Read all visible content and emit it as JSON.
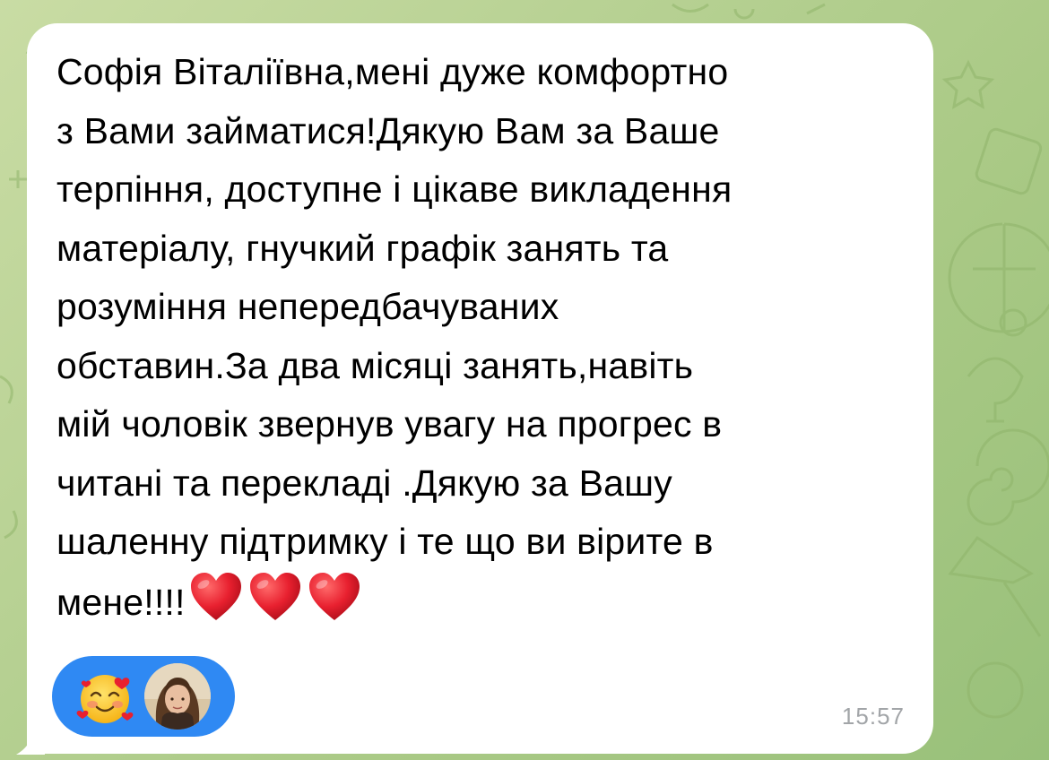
{
  "message": {
    "text": "Софія Віталіївна,мені дуже комфортно\nз Вами займатися!Дякую Вам за Ваше\nтерпіння, доступне і цікаве викладення\nматеріалу, гнучкий графік занять та\nрозуміння непередбачуваних\nобставин.За два місяці занять,навіть\nмій чоловік звернув увагу на прогрес в\nчитані та перекладі .Дякую за Вашу\nшаленну підтримку і те що ви вірите в\nмене!!!!",
    "emojis": [
      "heart-icon",
      "heart-icon",
      "heart-icon"
    ],
    "time": "15:57"
  },
  "reaction": {
    "emoji": "smiling-face-with-hearts-icon",
    "reactor": "avatar"
  },
  "colors": {
    "bubble": "#ffffff",
    "reaction_pill": "#2f89f3",
    "heart": "#e8202f",
    "timestamp": "#a2a5a8",
    "wallpaper": "#b7d193"
  }
}
